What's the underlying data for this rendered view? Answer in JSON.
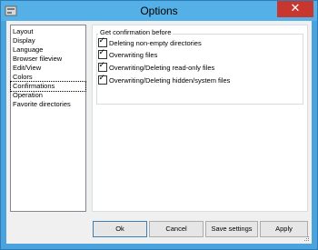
{
  "window": {
    "title": "Options",
    "close_glyph": "✕"
  },
  "nav": {
    "items": [
      {
        "label": "Layout"
      },
      {
        "label": "Display"
      },
      {
        "label": "Language"
      },
      {
        "label": "Browser fileview"
      },
      {
        "label": "Edit/View"
      },
      {
        "label": "Colors"
      },
      {
        "label": "Confirmations",
        "selected": true
      },
      {
        "label": "Operation"
      },
      {
        "label": "Favorite directories"
      }
    ]
  },
  "content": {
    "group_label": "Get confirmation before",
    "checkboxes": [
      {
        "label": "Deleting non-empty directories",
        "checked": true
      },
      {
        "label": "Overwriting files",
        "checked": true
      },
      {
        "label": "Overwriting/Deleting read-only files",
        "checked": true
      },
      {
        "label": "Overwriting/Deleting hidden/system files",
        "checked": true
      }
    ]
  },
  "buttons": {
    "ok": "Ok",
    "cancel": "Cancel",
    "save": "Save settings",
    "apply": "Apply"
  },
  "colors": {
    "titlebar": "#54b0e6",
    "close": "#c7372f",
    "client": "#f0f0f0"
  }
}
